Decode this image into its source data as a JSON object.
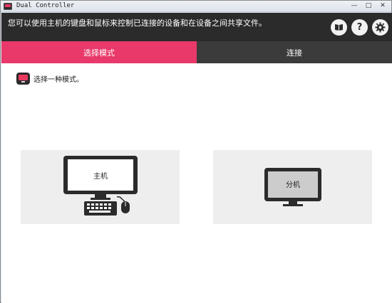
{
  "window": {
    "title": "Dual Controller",
    "minimize": "—",
    "maximize": "□",
    "close": "✕"
  },
  "header": {
    "text": "您可以使用主机的键盘和鼠标来控制已连接的设备和在设备之间共享文件。",
    "icons": [
      "manual-icon",
      "help-icon",
      "settings-icon"
    ],
    "help_glyph": "?",
    "settings_glyph": "⚙",
    "manual_glyph": "⊡"
  },
  "tabs": {
    "select_mode": "选择模式",
    "connect": "连接"
  },
  "main": {
    "hint": "选择一种模式。",
    "host_label": "主机",
    "guest_label": "分机"
  },
  "colors": {
    "accent": "#e8396a",
    "header_bg": "#2b2b2b",
    "tab_inactive": "#3b3b3b",
    "card_bg": "#eeeeee"
  }
}
